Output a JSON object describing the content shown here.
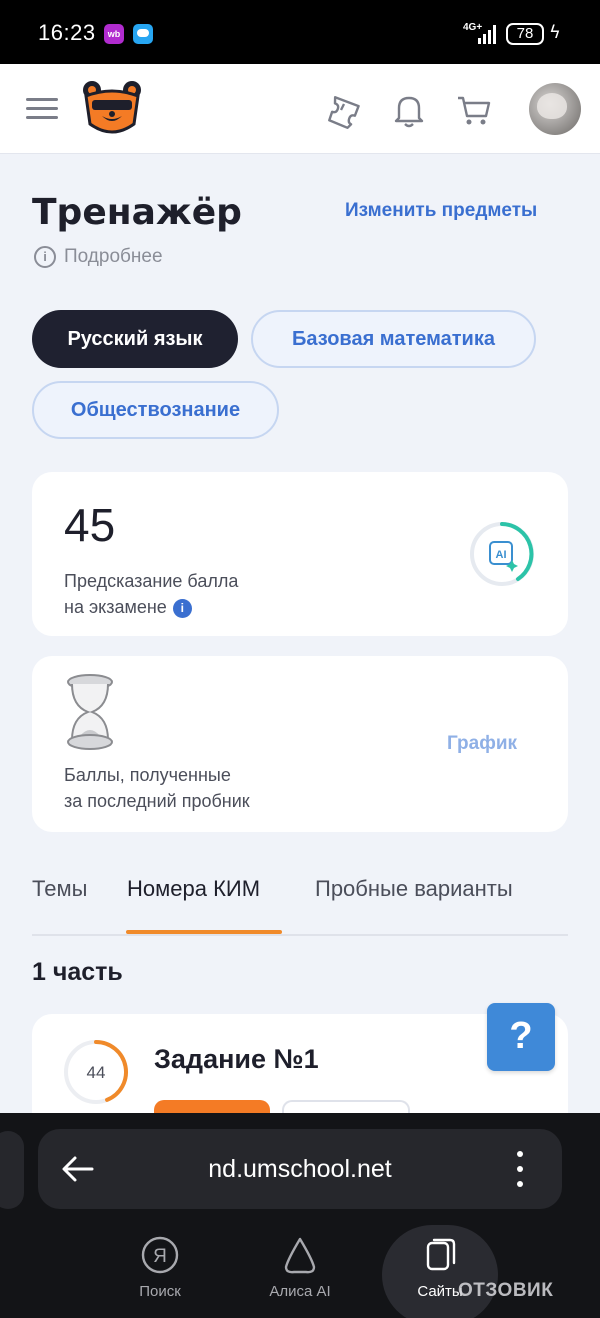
{
  "status_bar": {
    "time": "16:23",
    "wb_badge": "wb",
    "network": "4G+",
    "battery": "78"
  },
  "header": {
    "icons": [
      "menu-icon",
      "bear-logo",
      "ticket-icon",
      "bell-icon",
      "cart-icon",
      "avatar"
    ]
  },
  "page": {
    "title": "Тренажёр",
    "change_subjects": "Изменить предметы",
    "details": "Подробнее"
  },
  "subjects": [
    {
      "label": "Русский язык",
      "active": true
    },
    {
      "label": "Базовая математика",
      "active": false
    },
    {
      "label": "Обществознание",
      "active": false
    }
  ],
  "prediction_card": {
    "score": "45",
    "label_line1": "Предсказание балла",
    "label_line2": "на экзамене",
    "ai_badge": "AI"
  },
  "last_test_card": {
    "label_line1": "Баллы, полученные",
    "label_line2": "за последний пробник",
    "graph_link": "График"
  },
  "tabs": [
    {
      "label": "Темы",
      "active": false
    },
    {
      "label": "Номера КИМ",
      "active": true
    },
    {
      "label": "Пробные варианты",
      "active": false
    }
  ],
  "section": {
    "title": "1 часть"
  },
  "task": {
    "progress_value": "44",
    "progress_fraction": 0.44,
    "title": "Задание №1"
  },
  "help_button": "?",
  "browser": {
    "url": "nd.umschool.net",
    "nav": [
      {
        "label": "Поиск",
        "icon": "yandex-icon"
      },
      {
        "label": "Алиса AI",
        "icon": "alice-icon"
      },
      {
        "label": "Сайты",
        "icon": "tabs-icon"
      }
    ]
  },
  "watermark": "ОТЗОВИК",
  "colors": {
    "accent_blue": "#3a6fd0",
    "accent_orange": "#f08a2a",
    "dark_chip": "#1f2130",
    "help_blue": "#3f89d8",
    "ai_ring_teal": "#2cc3a8"
  }
}
